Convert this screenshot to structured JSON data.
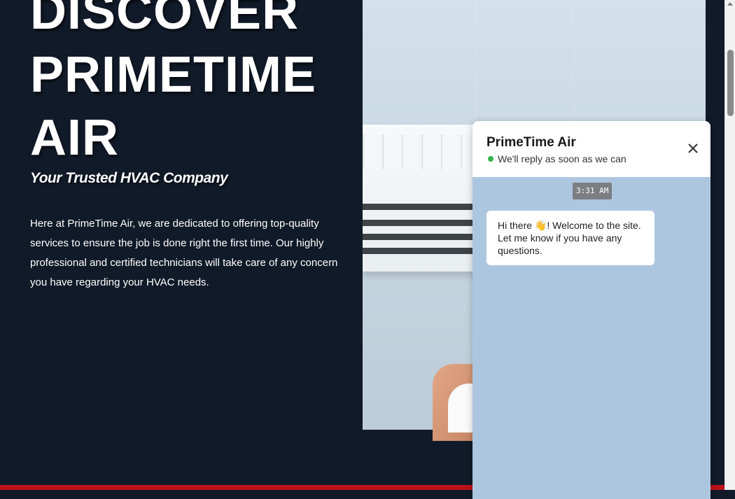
{
  "hero": {
    "title_line1": "DISCOVER",
    "title_line2": "PRIMETIME",
    "title_line3": "AIR",
    "tagline": "Your Trusted HVAC Company",
    "intro": "Here at PrimeTime Air, we are dedicated to offering top-quality services to ensure the job is done right the first time. Our highly professional and certified technicians will take care of any concern you have regarding your HVAC needs."
  },
  "chat": {
    "name": "PrimeTime Air",
    "status": "We'll reply as soon as we can",
    "status_color": "#35b34a",
    "close_icon": "close-icon",
    "timestamp": "3:31 AM",
    "message": "Hi there 👋! Welcome to the site. Let me know if you have any questions."
  },
  "colors": {
    "background": "#111a28",
    "accent_bar": "#c0111a",
    "chat_panel": "#adc6e0"
  }
}
